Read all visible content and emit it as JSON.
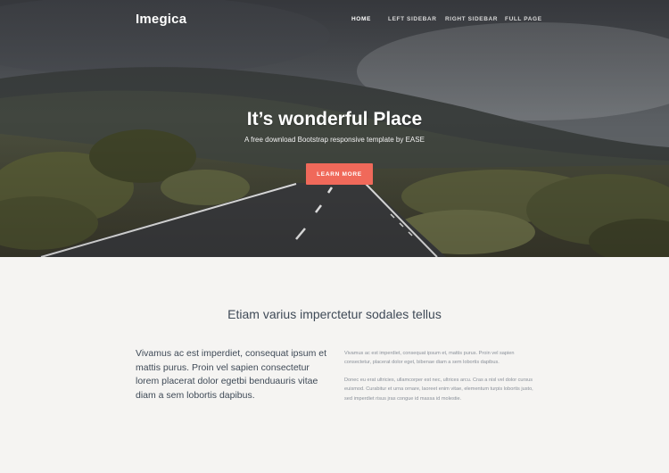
{
  "nav": {
    "brand": "Imegica",
    "links": [
      {
        "label": "HOME",
        "active": true
      },
      {
        "label": "LEFT SIDEBAR",
        "active": false
      },
      {
        "label": "RIGHT SIDEBAR",
        "active": false
      },
      {
        "label": "FULL PAGE",
        "active": false
      }
    ]
  },
  "hero": {
    "title": "It’s wonderful Place",
    "subtitle": "A free download Bootstrap responsive template by EASE",
    "cta_label": "LEARN MORE",
    "cta_color": "#f0695a"
  },
  "content": {
    "heading": "Etiam varius imperctetur sodales tellus",
    "lead": "Vivamus ac est imperdiet, consequat ipsum et mattis purus. Proin vel sapien consectetur lorem placerat dolor egetbi benduauris vitae diam a sem lobortis dapibus.",
    "paragraph1": "Vivamus ac est imperdiet, consequat ipsum et, mattis purus. Proin vel sapien consectetur, placerat dolor eget, bibenae diam a sem lobortis dapibus.",
    "paragraph2": "Donec eu erat ultricies, ullamcorper est nec, ultrices arcu. Cras a nisl vel dolor cursus euismod. Curabitur et urna ornare, laoreet enim vitae, elementum turpis lobortis justo, sed imperdiet risus jras congue id massa id molestie."
  }
}
